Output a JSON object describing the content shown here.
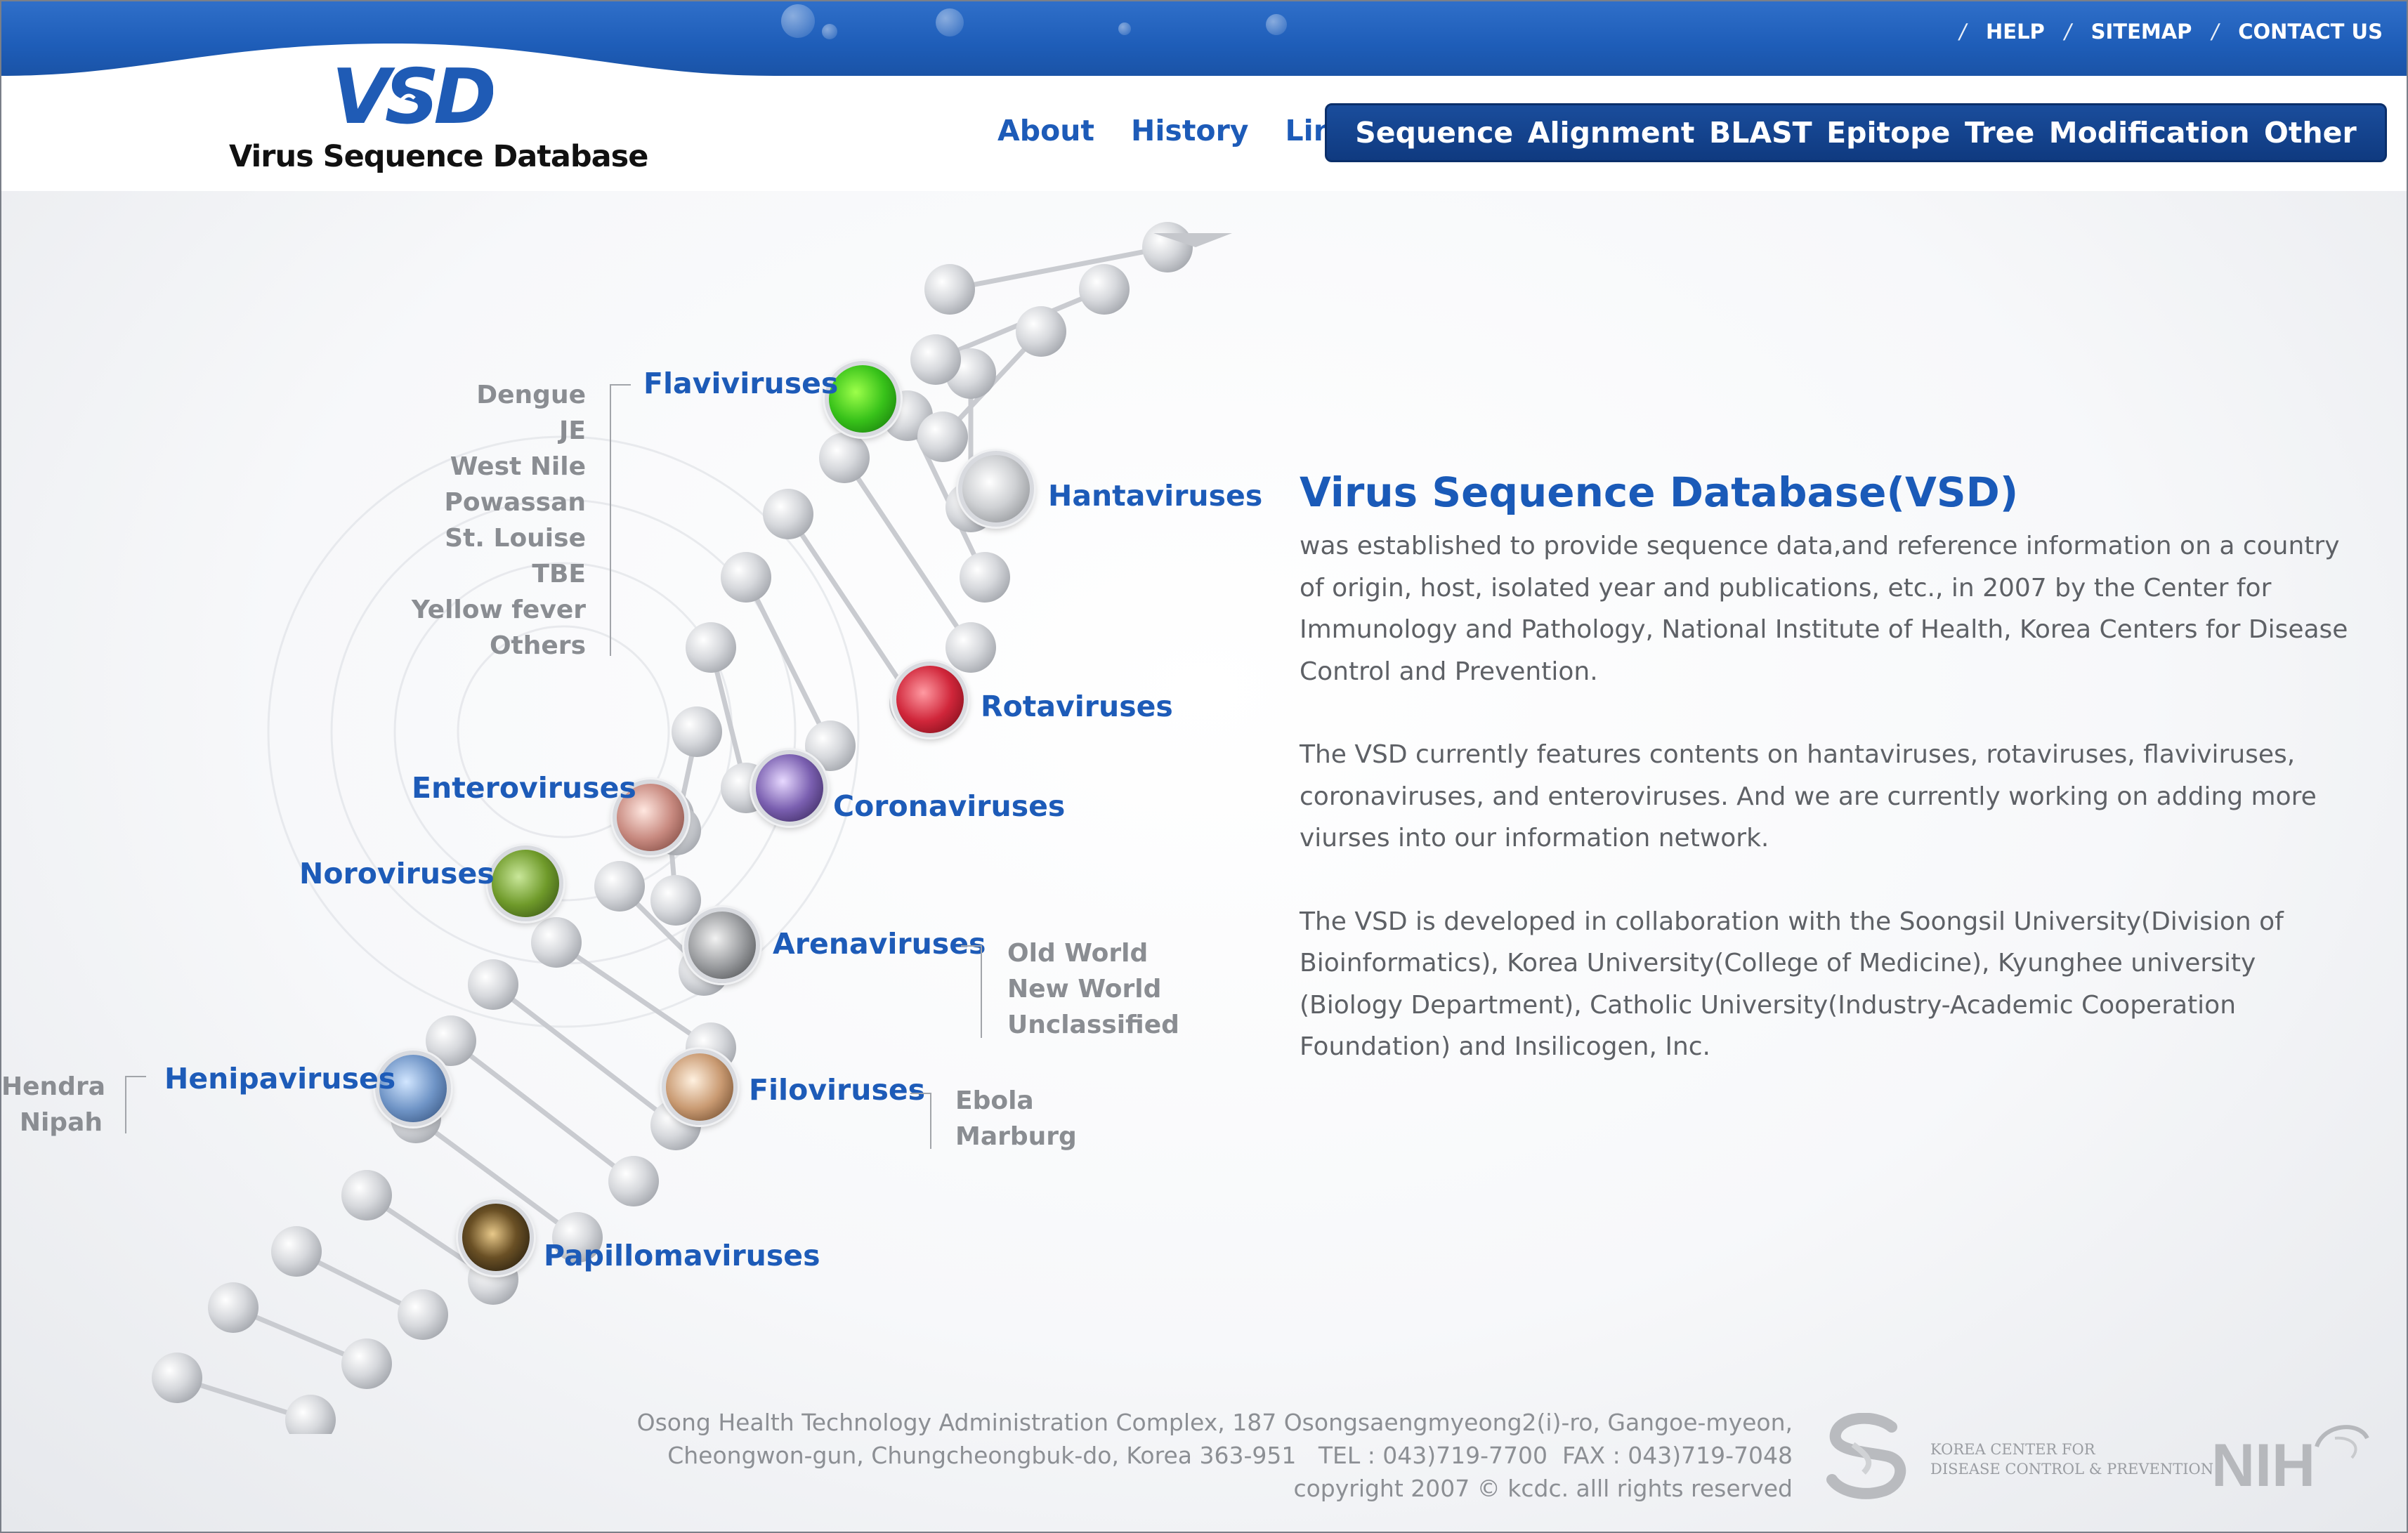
{
  "utility_nav": {
    "help": "HELP",
    "sitemap": "SITEMAP",
    "contact": "CONTACT US"
  },
  "logo": {
    "mark": "VSD",
    "title": "Virus Sequence Database"
  },
  "nav_secondary": [
    "About",
    "History",
    "Link"
  ],
  "nav_main": [
    "Sequence",
    "Alignment",
    "BLAST",
    "Epitope",
    "Tree",
    "Modification",
    "Other"
  ],
  "viruses": {
    "flavi": {
      "label": "Flaviviruses",
      "sub": [
        "Dengue",
        "JE",
        "West Nile",
        "Powassan",
        "St. Louise",
        "TBE",
        "Yellow fever",
        "Others"
      ]
    },
    "hanta": {
      "label": "Hantaviruses"
    },
    "rota": {
      "label": "Rotaviruses"
    },
    "corona": {
      "label": "Coronaviruses"
    },
    "entero": {
      "label": "Enteroviruses"
    },
    "noro": {
      "label": "Noroviruses"
    },
    "arena": {
      "label": "Arenaviruses",
      "sub": [
        "Old World",
        "New World",
        "Unclassified"
      ]
    },
    "henipa": {
      "label": "Henipaviruses",
      "sub": [
        "Hendra",
        "Nipah"
      ]
    },
    "filo": {
      "label": "Filoviruses",
      "sub": [
        "Ebola",
        "Marburg"
      ]
    },
    "papilloma": {
      "label": "Papillomaviruses"
    }
  },
  "intro": {
    "title": "Virus Sequence Database(VSD)",
    "p1": "was established to provide sequence data,and reference information on a country of origin, host, isolated year and publications, etc., in 2007 by the Center for Immunology and Pathology, National Institute of Health, Korea Centers for Disease Control and Prevention.",
    "p2": "The VSD currently features contents on hantaviruses, rotaviruses, flaviviruses, coronaviruses, and enteroviruses. And we are currently working on adding more viurses into our information network.",
    "p3": "The VSD is developed in collaboration with the Soongsil University(Division of Bioinformatics), Korea University(College of Medicine), Kyunghee university (Biology Department), Catholic University(Industry-Academic Cooperation Foundation) and Insilicogen, Inc."
  },
  "footer": {
    "line1": "Osong Health Technology Administration Complex, 187 Osongsaengmyeong2(i)-ro, Gangoe-myeon,",
    "line2": "Cheongwon-gun, Chungcheongbuk-do, Korea 363-951   TEL : 043)719-7700  FAX : 043)719-7048",
    "line3": "copyright 2007 © kcdc. alll rights reserved",
    "kcdc_line1": "KOREA CENTER FOR",
    "kcdc_line2": "DISEASE CONTROL & PREVENTION",
    "nih": "NIH"
  },
  "colors": {
    "brand_blue": "#1d5bb8",
    "nav_dark": "#0f3a80",
    "topbar": "#1e5db8"
  }
}
